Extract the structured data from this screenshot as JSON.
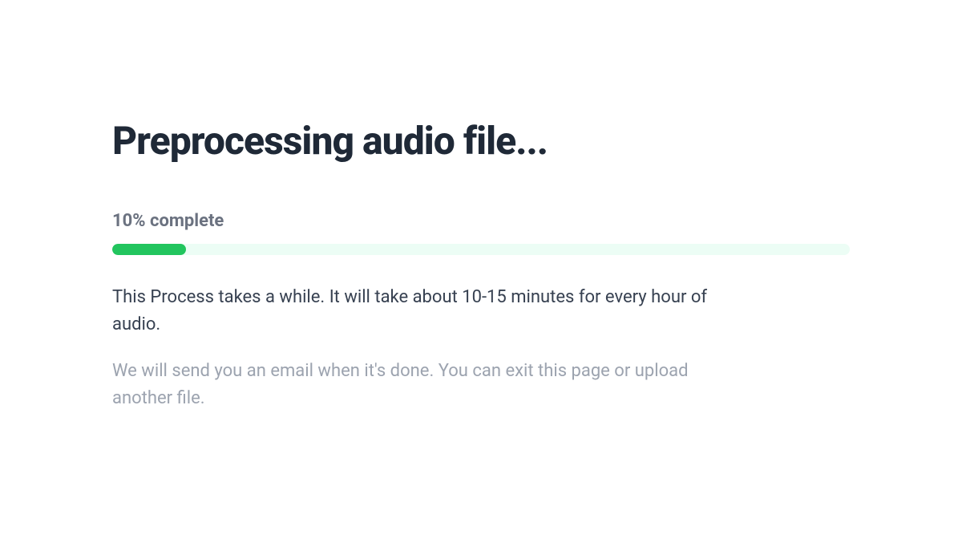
{
  "title": "Preprocessing audio file...",
  "progress": {
    "percent": 10,
    "label": "10% complete",
    "width_style": "width: 10%"
  },
  "messages": {
    "primary": "This Process takes a while. It will take about 10-15 minutes for every hour of audio.",
    "secondary": "We will send you an email when it's done. You can exit this page or upload another file."
  }
}
